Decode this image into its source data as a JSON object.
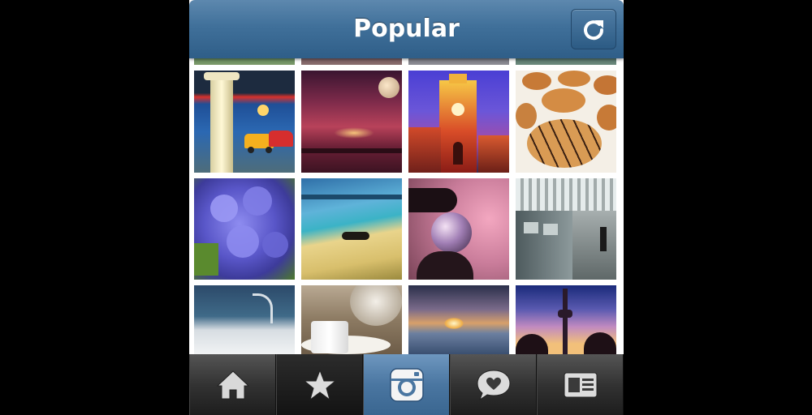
{
  "nav": {
    "title": "Popular",
    "refresh_icon": "refresh-icon"
  },
  "colors": {
    "nav_blue": "#40709a",
    "active_tab_blue": "#4a76a1",
    "tabbar_dark": "#333333"
  },
  "grid": {
    "columns": 4,
    "photos": [
      "tile-partial-1",
      "tile-partial-2",
      "tile-partial-3",
      "tile-partial-4",
      "column-with-vintage-cars",
      "stormy-sky-with-moon",
      "clock-tower-at-dusk",
      "chocolate-drizzled-cookies",
      "blue-flowers",
      "beach-with-reclining-person",
      "glass-sphere-in-hand",
      "subway-train-station",
      "water-scene",
      "cat-and-milk-glass",
      "sunset-over-water",
      "tower-at-sunset"
    ]
  },
  "tabbar": {
    "items": [
      {
        "name": "home",
        "icon": "home-icon",
        "active": false
      },
      {
        "name": "popular",
        "icon": "star-icon",
        "active": false
      },
      {
        "name": "camera",
        "icon": "camera-icon",
        "active": true
      },
      {
        "name": "news",
        "icon": "speech-bubble-heart-icon",
        "active": false
      },
      {
        "name": "profile",
        "icon": "profile-card-icon",
        "active": false
      }
    ]
  }
}
